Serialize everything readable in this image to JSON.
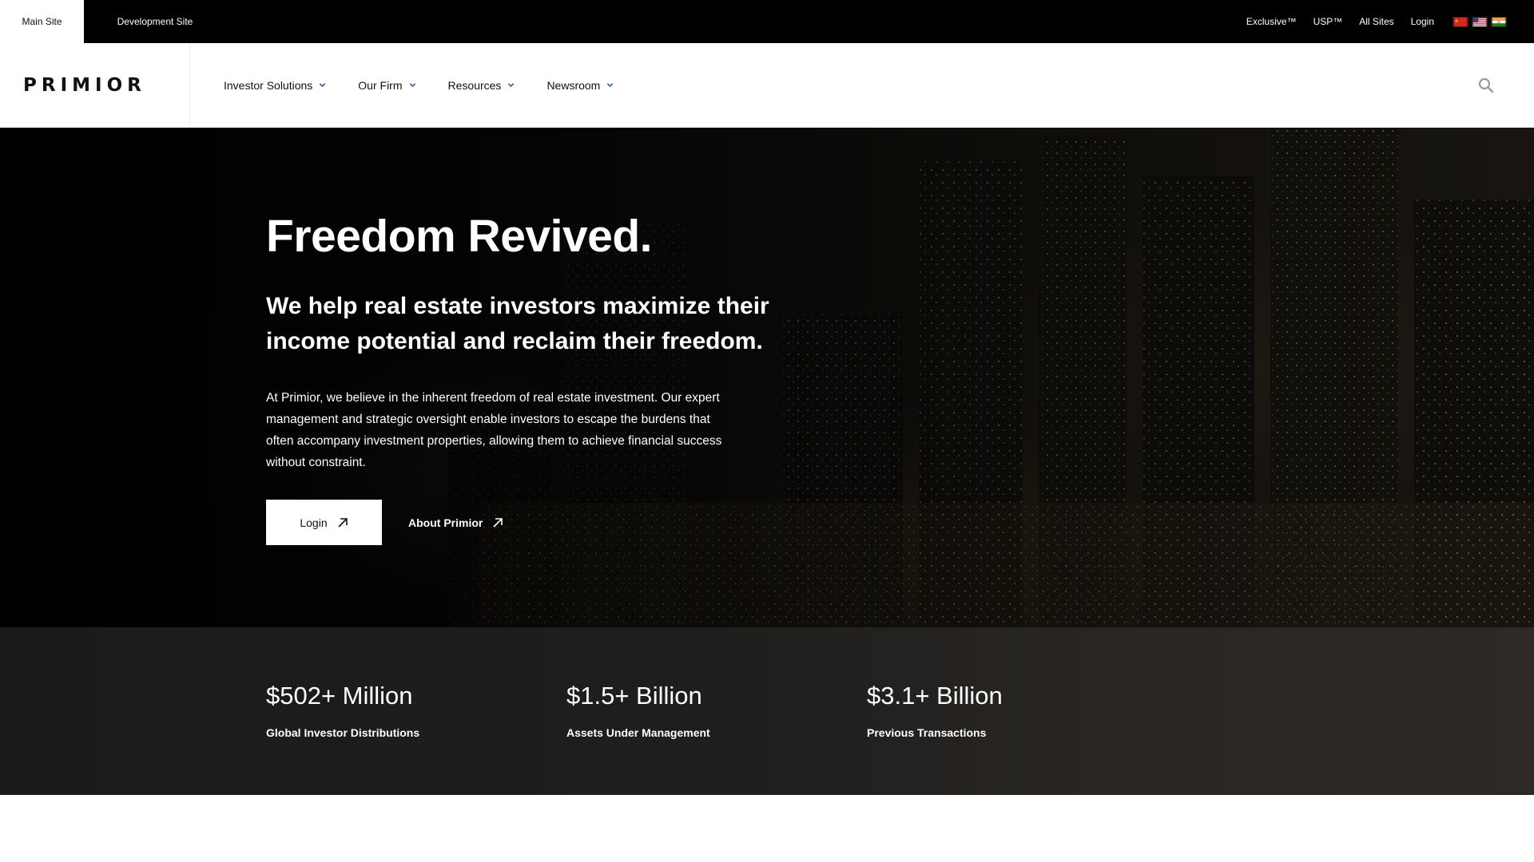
{
  "topbar": {
    "site_tabs": [
      {
        "label": "Main Site",
        "active": true
      },
      {
        "label": "Development Site",
        "active": false
      }
    ],
    "links": [
      "Exclusive™",
      "USP™",
      "All Sites",
      "Login"
    ],
    "flags": [
      {
        "name": "china-flag-icon",
        "colors": [
          "#d9261c",
          "#f5c518"
        ]
      },
      {
        "name": "usa-flag-icon",
        "colors": [
          "#b22234",
          "#ffffff",
          "#3c3b6e"
        ]
      },
      {
        "name": "india-flag-icon",
        "colors": [
          "#ff9933",
          "#ffffff",
          "#138808"
        ]
      }
    ]
  },
  "nav": {
    "logo": "PRIMIOR",
    "items": [
      "Investor Solutions",
      "Our Firm",
      "Resources",
      "Newsroom"
    ],
    "chevron_color": "#1f5fbf",
    "search_icon": "search-icon"
  },
  "hero": {
    "title": "Freedom Revived.",
    "subtitle": "We help real estate investors maximize their income potential and reclaim their freedom.",
    "body": "At Primior, we believe in the inherent freedom of real estate investment. Our expert management and strategic oversight enable investors to escape the burdens that often accompany investment properties, allowing them to achieve financial success without constraint.",
    "primary_button": "Login",
    "secondary_button": "About Primior"
  },
  "stats": [
    {
      "value": "$502+ Million",
      "label": "Global Investor Distributions"
    },
    {
      "value": "$1.5+ Billion",
      "label": "Assets Under Management"
    },
    {
      "value": "$3.1+ Billion",
      "label": "Previous Transactions"
    }
  ]
}
